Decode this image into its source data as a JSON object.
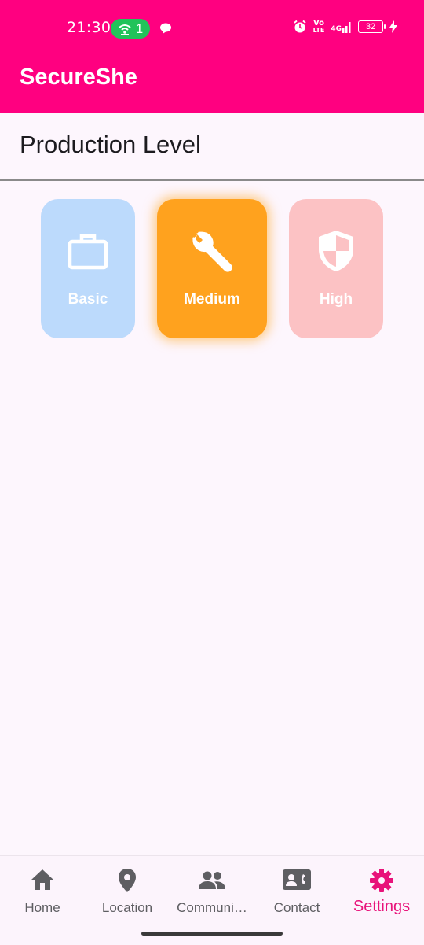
{
  "status_bar": {
    "time": "21:30",
    "hotspot_count": "1",
    "network_volte": "Vo",
    "network_lte": "LTE",
    "network_gen": "4G",
    "battery_level": "32"
  },
  "app_bar": {
    "title": "SecureShe",
    "background": "#ff0080"
  },
  "section": {
    "title": "Production Level"
  },
  "levels": [
    {
      "label": "Basic",
      "icon": "briefcase-icon",
      "color": "#bcdafc"
    },
    {
      "label": "Medium",
      "icon": "wrench-icon",
      "color": "#ffa21e",
      "selected": true
    },
    {
      "label": "High",
      "icon": "shield-icon",
      "color": "#fcc2c4"
    }
  ],
  "bottom_nav": {
    "items": [
      {
        "label": "Home",
        "icon": "home-icon"
      },
      {
        "label": "Location",
        "icon": "location-pin-icon"
      },
      {
        "label": "Communi…",
        "icon": "people-icon"
      },
      {
        "label": "Contact",
        "icon": "contact-card-icon"
      },
      {
        "label": "Settings",
        "icon": "gear-icon",
        "active": true
      }
    ],
    "active_color": "#e8137a"
  }
}
